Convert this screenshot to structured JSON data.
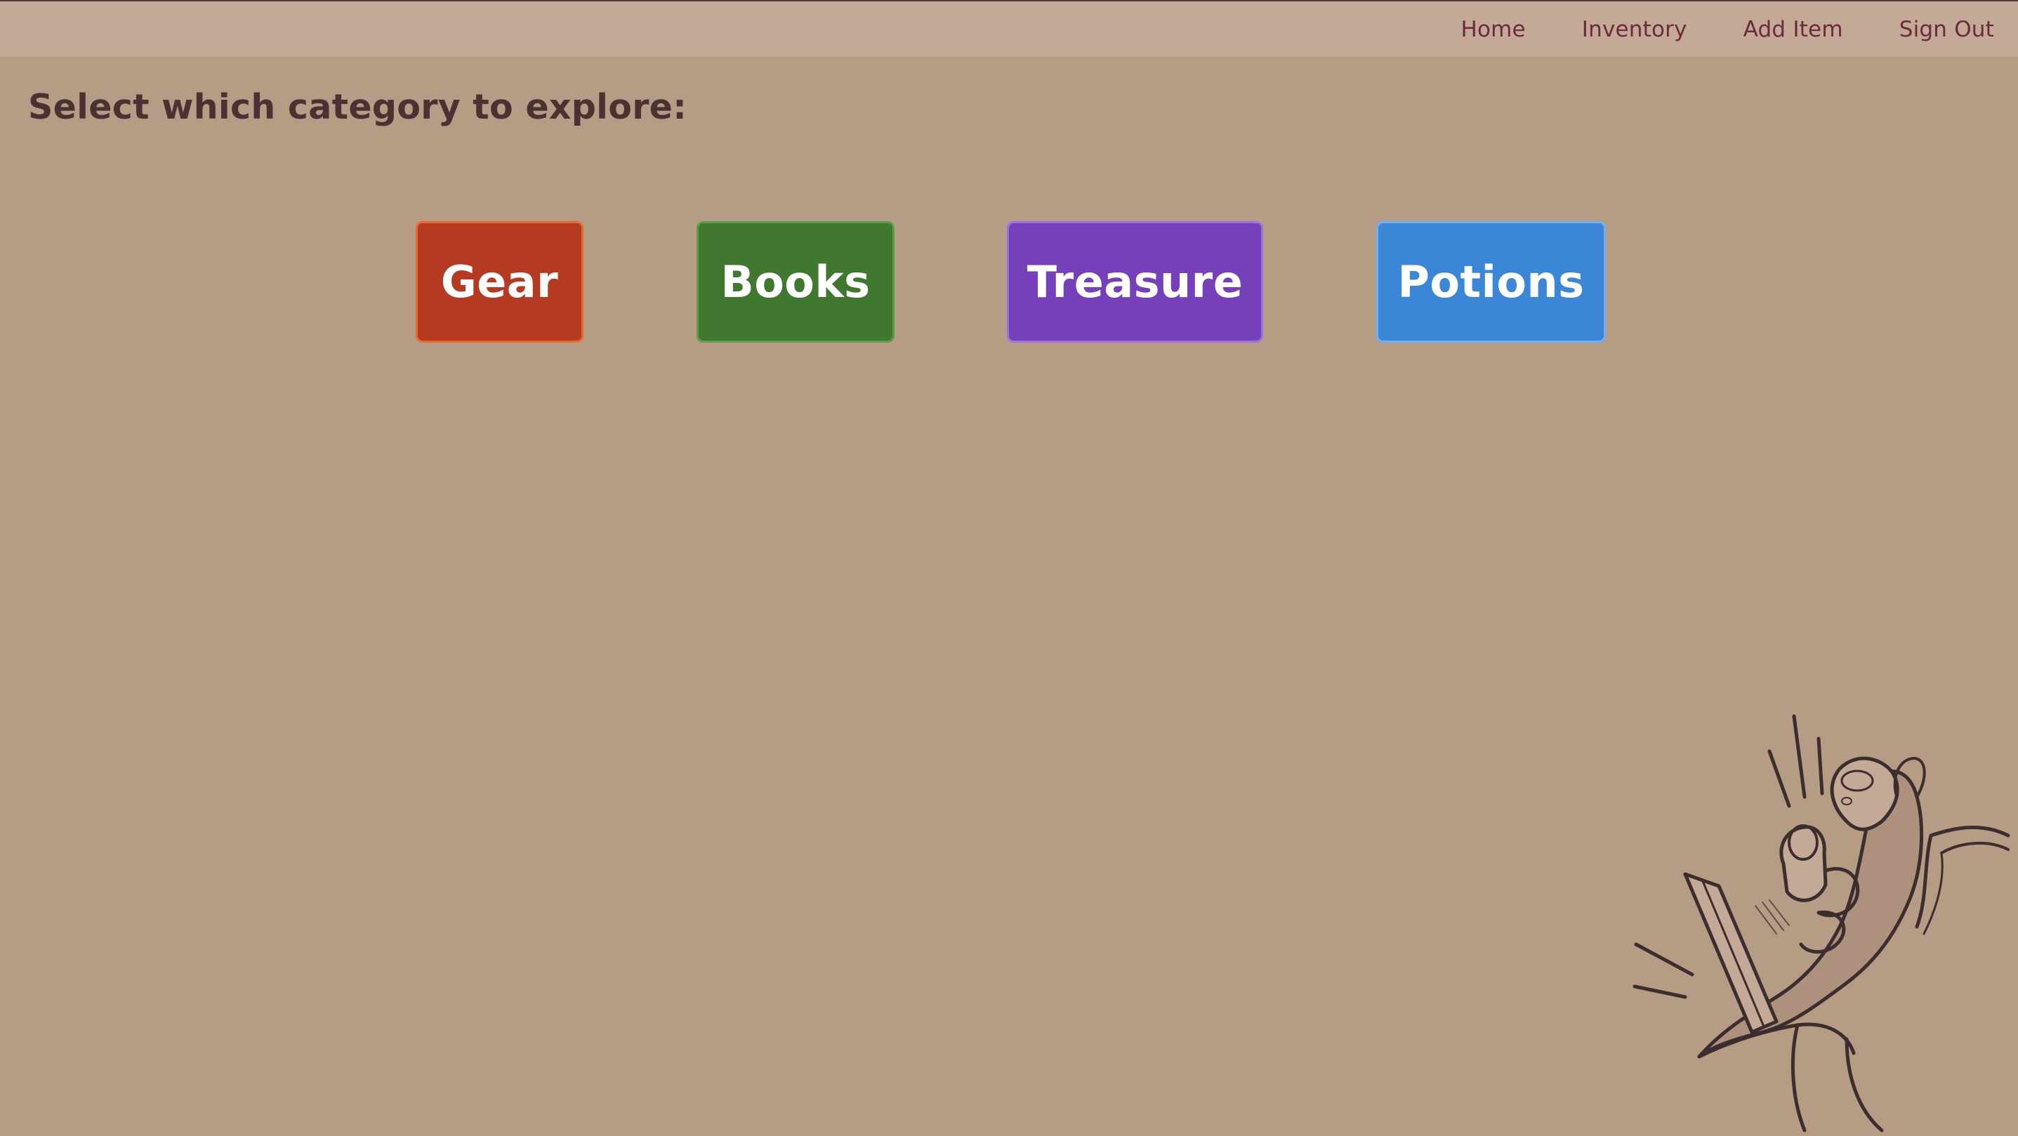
{
  "nav": {
    "links": [
      "Home",
      "Inventory",
      "Add Item",
      "Sign Out"
    ]
  },
  "main": {
    "heading": "Select which category to explore:",
    "categories": [
      {
        "label": "Gear",
        "color": "#b53a22"
      },
      {
        "label": "Books",
        "color": "#41782f"
      },
      {
        "label": "Treasure",
        "color": "#7640bb"
      },
      {
        "label": "Potions",
        "color": "#3c86d8"
      }
    ]
  },
  "illustration": {
    "icon": "hand-holding-treasure-illustration"
  },
  "colors": {
    "background": "#b69b85",
    "topbar": "#c3a996",
    "nav_text": "#6b2b3b",
    "heading_text": "#4a3232"
  }
}
